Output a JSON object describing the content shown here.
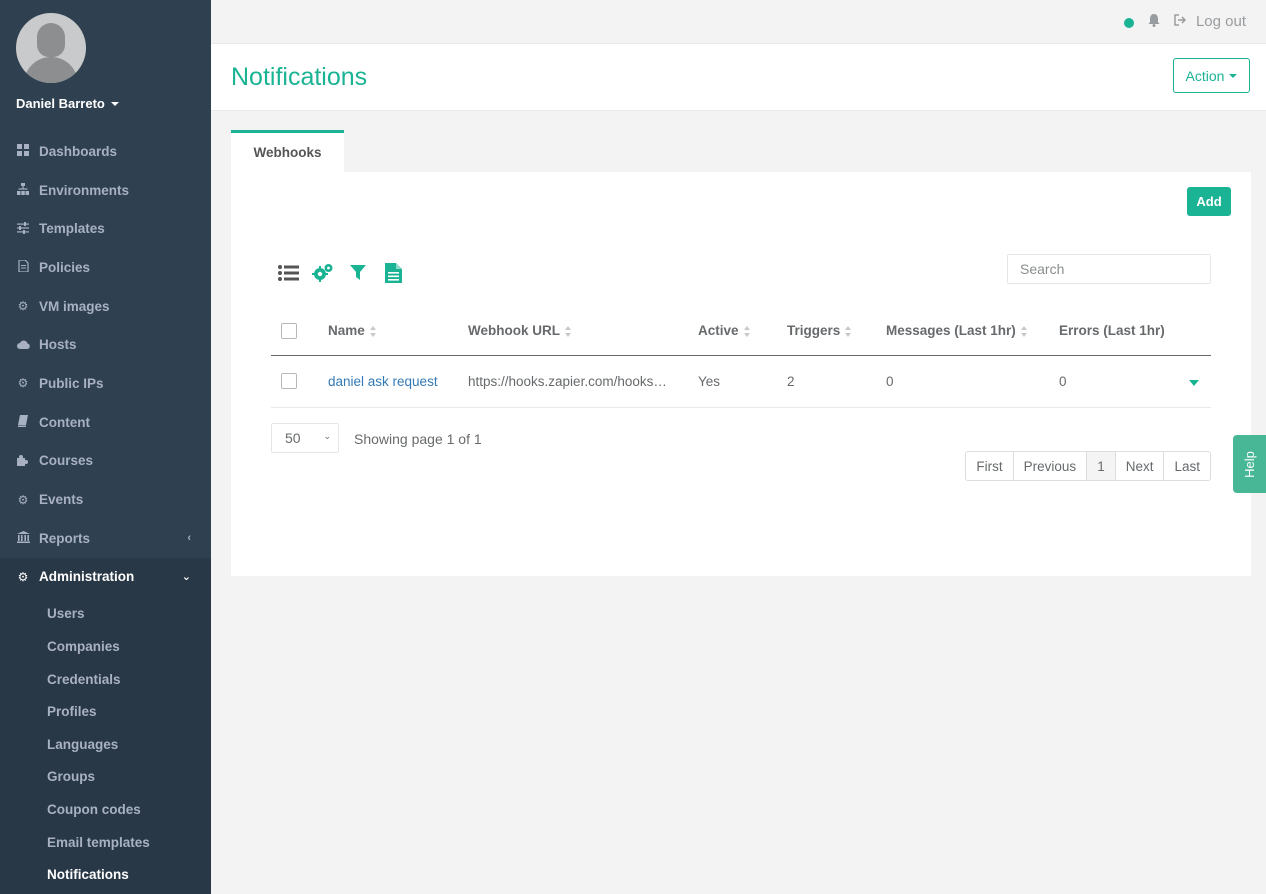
{
  "user": {
    "name": "Daniel Barreto"
  },
  "sidebar": {
    "items": [
      {
        "label": "Dashboards",
        "icon": "dashboard-icon"
      },
      {
        "label": "Environments",
        "icon": "sitemap-icon"
      },
      {
        "label": "Templates",
        "icon": "sliders-icon"
      },
      {
        "label": "Policies",
        "icon": "document-icon"
      },
      {
        "label": "VM images",
        "icon": "cogs-icon"
      },
      {
        "label": "Hosts",
        "icon": "cloud-icon"
      },
      {
        "label": "Public IPs",
        "icon": "cogs-icon"
      },
      {
        "label": "Content",
        "icon": "book-icon"
      },
      {
        "label": "Courses",
        "icon": "puzzle-icon"
      },
      {
        "label": "Events",
        "icon": "cogs-icon"
      },
      {
        "label": "Reports",
        "icon": "bank-icon"
      },
      {
        "label": "Administration",
        "icon": "cogs-icon"
      }
    ],
    "admin_items": [
      {
        "label": "Users"
      },
      {
        "label": "Companies"
      },
      {
        "label": "Credentials"
      },
      {
        "label": "Profiles"
      },
      {
        "label": "Languages"
      },
      {
        "label": "Groups"
      },
      {
        "label": "Coupon codes"
      },
      {
        "label": "Email templates"
      },
      {
        "label": "Notifications"
      }
    ]
  },
  "topbar": {
    "logout_label": "Log out",
    "status_color": "#1ab394"
  },
  "page": {
    "title": "Notifications",
    "action_label": "Action"
  },
  "tabs": [
    {
      "label": "Webhooks"
    }
  ],
  "panel": {
    "add_label": "Add",
    "search_placeholder": "Search",
    "columns": [
      "Name",
      "Webhook URL",
      "Active",
      "Triggers",
      "Messages (Last 1hr)",
      "Errors (Last 1hr)"
    ],
    "rows": [
      {
        "name": "daniel ask request",
        "url": "https://hooks.zapier.com/hooks/catch/",
        "active": "Yes",
        "triggers": "2",
        "messages": "0",
        "errors": "0"
      }
    ],
    "per_page": "50",
    "page_info": "Showing page 1 of 1",
    "pagination": {
      "first": "First",
      "previous": "Previous",
      "current": "1",
      "next": "Next",
      "last": "Last"
    }
  },
  "help_label": "Help",
  "colors": {
    "accent": "#1ab394",
    "sidebar_bg": "#2f4050",
    "link": "#337ab7"
  }
}
